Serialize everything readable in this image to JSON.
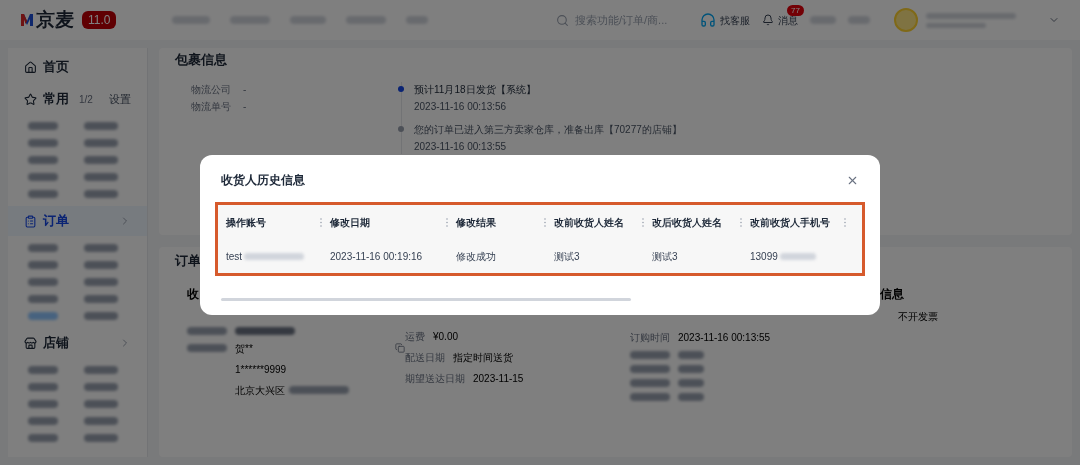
{
  "header": {
    "logo": "京麦",
    "version": "11.0",
    "search": {
      "placeholder": "搜索功能/订单/商..."
    },
    "service": "找客服",
    "messages": {
      "label": "消息",
      "badge": "77"
    }
  },
  "sidebar": {
    "items": [
      {
        "label": "首页",
        "selected": false
      },
      {
        "label": "常用",
        "selected": false,
        "pager": "1/2",
        "action": "设置"
      },
      {
        "label": "订单",
        "selected": true
      },
      {
        "label": "店铺",
        "selected": false
      }
    ]
  },
  "package": {
    "title": "包裹信息",
    "fields": [
      {
        "label": "物流公司",
        "value": "-"
      },
      {
        "label": "物流单号",
        "value": "-"
      }
    ],
    "timeline": [
      {
        "text": "预计11月18日发货【系统】",
        "time": "2023-11-16 00:13:56",
        "current": true
      },
      {
        "text": "您的订单已进入第三方卖家仓库，准备出库【70277的店铺】",
        "time": "2023-11-16 00:13:55",
        "current": false
      }
    ]
  },
  "order": {
    "title": "订单",
    "receiver": {
      "title": "收",
      "name": "贺**",
      "phone": "1******9999",
      "address": "北京大兴区"
    },
    "delivery": [
      {
        "label": "运费",
        "value": "¥0.00"
      },
      {
        "label": "配送日期",
        "value": "指定时间送货"
      },
      {
        "label": "期望送达日期",
        "value": "2023-11-15"
      }
    ],
    "info": {
      "title": "信息",
      "invoice": "不开发票",
      "time_label": "订购时间",
      "time": "2023-11-16 00:13:55"
    }
  },
  "dialog": {
    "title": "收货人历史信息",
    "columns": [
      "操作账号",
      "修改日期",
      "修改结果",
      "改前收货人姓名",
      "改后收货人姓名",
      "改前收货人手机号"
    ],
    "rows": [
      {
        "cells": [
          "test",
          "2023-11-16 00:19:16",
          "修改成功",
          "测试3",
          "测试3",
          "13099"
        ]
      }
    ]
  }
}
